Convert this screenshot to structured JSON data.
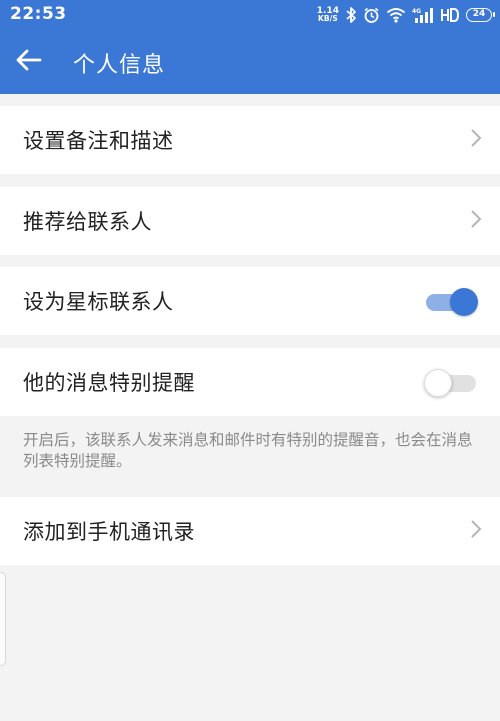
{
  "status_bar": {
    "time": "22:53",
    "net_speed_value": "1.14",
    "net_speed_unit": "KB/S",
    "battery_level": "24",
    "icons": [
      "bluetooth-icon",
      "alarm-icon",
      "wifi-icon",
      "signal-icon",
      "hd-icon",
      "battery-icon"
    ]
  },
  "header": {
    "title": "个人信息",
    "back_icon": "arrow-left-icon"
  },
  "rows": [
    {
      "label": "设置备注和描述",
      "control": "chevron"
    },
    {
      "label": "推荐给联系人",
      "control": "chevron"
    },
    {
      "label": "设为星标联系人",
      "control": "toggle",
      "toggle_on": true
    },
    {
      "label": "他的消息特别提醒",
      "control": "toggle",
      "toggle_on": false
    },
    {
      "label": "添加到手机通讯录",
      "control": "chevron"
    }
  ],
  "hint": "开启后，该联系人发来消息和邮件时有特别的提醒音，也会在消息列表特别提醒。",
  "colors": {
    "accent": "#3b78d6",
    "background": "#f3f3f3",
    "row_background": "#ffffff",
    "hint_text": "#8a8a8a"
  }
}
